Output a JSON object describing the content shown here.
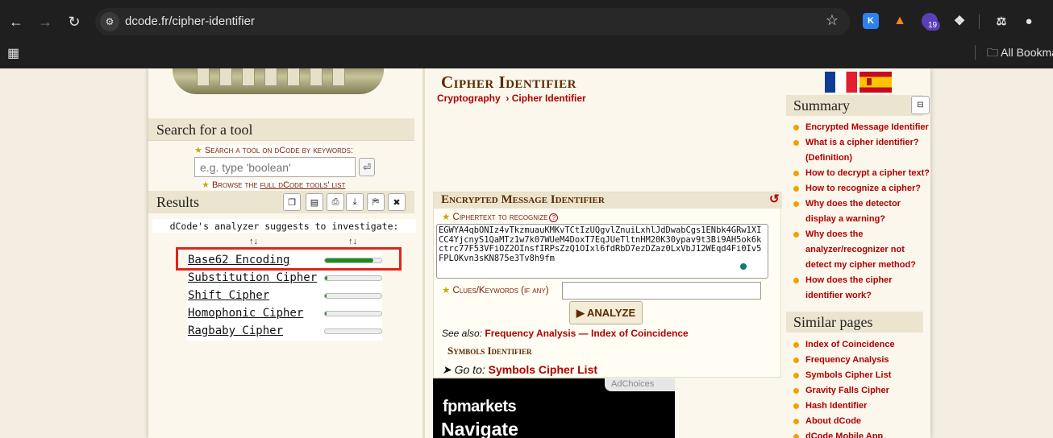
{
  "browser": {
    "url": "dcode.fr/cipher-identifier",
    "extensions": {
      "k_label": "K",
      "badge_count": "19"
    },
    "bookmarks_folder": "All Bookmarks",
    "colors": {
      "chrome_bg": "#1f1f1f",
      "omnibox_bg": "#282828"
    }
  },
  "left": {
    "search_title": "Search for a tool",
    "search_label": "Search a tool on dCode by keywords:",
    "search_placeholder": "e.g. type 'boolean'",
    "browse_prefix": "Browse the ",
    "browse_link": "full dCode tools' list",
    "results_title": "Results",
    "suggest_text": "dCode's analyzer suggests to investigate:",
    "sort_glyph": "↑↓",
    "results": [
      {
        "name": "Base62 Encoding",
        "score": 0.86
      },
      {
        "name": "Substitution Cipher",
        "score": 0.04
      },
      {
        "name": "Shift Cipher",
        "score": 0.03
      },
      {
        "name": "Homophonic Cipher",
        "score": 0.03
      },
      {
        "name": "Ragbaby Cipher",
        "score": 0.0
      }
    ],
    "highlight_color": "#e1251b"
  },
  "center": {
    "title": "Cipher Identifier",
    "breadcrumb": [
      "Cryptography",
      "› Cipher Identifier"
    ],
    "tool_title": "Encrypted Message Identifier",
    "ciphertext_label": "Ciphertext to recognize",
    "ciphertext": "EGWYA4qbONIz4vTkzmuauKMKvTCtIzUQgvlZnuiLxhlJdDwabCgs1ENbk4GRw1XICC4YjcnyS1QaMTz1w7k07WUeM4DoxT7EqJUeTltnHM20K30ypav9t3Bi9AH5ok6kctrc77F53VFiOZ2OInsfIRPsZzQ1OIxl6fdRbD7ezDZaz0LxVbJ12WEqd4Fi0Iv5FPLOKvn3sKN875e3Tv8h9fm",
    "clues_label": "Clues/Keywords (if any)",
    "analyze_label": "▶ ANALYZE",
    "see_also_label": "See also:",
    "see_also_links": [
      "Frequency Analysis",
      "—",
      "Index of Coincidence"
    ],
    "symbols_title": "Symbols Identifier",
    "goto_label": "➤ Go to:",
    "goto_link": "Symbols Cipher List",
    "ad": {
      "choices": "AdChoices",
      "brand": "fpmarkets",
      "headline": "Navigate"
    }
  },
  "right": {
    "summary_title": "Summary",
    "summary_items": [
      "Encrypted Message Identifier",
      "What is a cipher identifier? (Definition)",
      "How to decrypt a cipher text?",
      "How to recognize a cipher?",
      "Why does the detector display a warning?",
      "Why does the analyzer/recognizer not detect my cipher method?",
      "How does the cipher identifier work?"
    ],
    "similar_title": "Similar pages",
    "similar_items": [
      "Index of Coincidence",
      "Frequency Analysis",
      "Symbols Cipher List",
      "Gravity Falls Cipher",
      "Hash Identifier",
      "About dCode",
      "dCode Mobile App"
    ]
  }
}
